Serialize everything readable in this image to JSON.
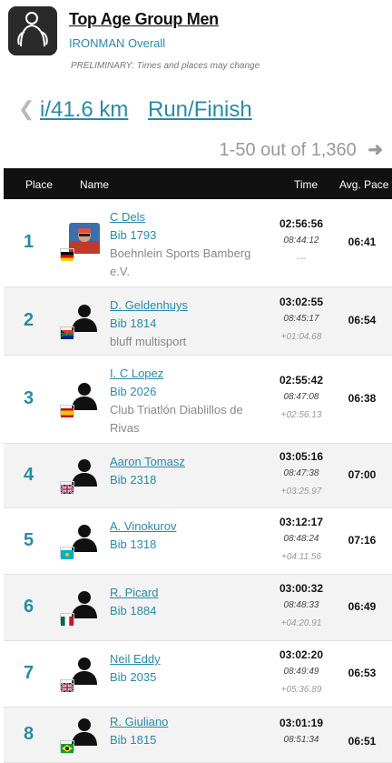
{
  "header": {
    "title": "Top Age Group Men",
    "subtitle": "IRONMAN Overall",
    "notice": "PRELIMINARY: Times and places may change"
  },
  "split_nav": {
    "distance": "i/41.6 km",
    "label": "Run/Finish"
  },
  "paging": {
    "text": "1-50 out of 1,360"
  },
  "table": {
    "headers": {
      "place": "Place",
      "name": "Name",
      "time": "Time",
      "pace": "Avg. Pace"
    },
    "rows": [
      {
        "place": "1",
        "name": "C Dels",
        "bib": "Bib 1793",
        "club_line1": "Boehnlein Sports Bamberg",
        "club_line2": "e.V.",
        "time": "02:56:56",
        "race_time": "08:44:12",
        "gap": "---",
        "pace": "06:41",
        "flag": "germany"
      },
      {
        "place": "2",
        "name": "D. Geldenhuys",
        "bib": "Bib 1814",
        "club_line1": "bluff multisport",
        "club_line2": "",
        "time": "03:02:55",
        "race_time": "08:45:17",
        "gap": "+01:04.68",
        "pace": "06:54",
        "flag": "south-africa"
      },
      {
        "place": "3",
        "name": "I. C Lopez",
        "bib": "Bib 2026",
        "club_line1": "Club Triatlón Diablillos de",
        "club_line2": "Rivas",
        "time": "02:55:42",
        "race_time": "08:47:08",
        "gap": "+02:56.13",
        "pace": "06:38",
        "flag": "spain"
      },
      {
        "place": "4",
        "name": "Aaron Tomasz",
        "bib": "Bib 2318",
        "club_line1": "",
        "club_line2": "",
        "time": "03:05:16",
        "race_time": "08:47:38",
        "gap": "+03:25.97",
        "pace": "07:00",
        "flag": "uk"
      },
      {
        "place": "5",
        "name": "A. Vinokurov",
        "bib": "Bib 1318",
        "club_line1": "",
        "club_line2": "",
        "time": "03:12:17",
        "race_time": "08:48:24",
        "gap": "+04:11.56",
        "pace": "07:16",
        "flag": "kazakhstan"
      },
      {
        "place": "6",
        "name": "R. Picard",
        "bib": "Bib 1884",
        "club_line1": "",
        "club_line2": "",
        "time": "03:00:32",
        "race_time": "08:48:33",
        "gap": "+04:20.91",
        "pace": "06:49",
        "flag": "mexico"
      },
      {
        "place": "7",
        "name": "Neil Eddy",
        "bib": "Bib 2035",
        "club_line1": "",
        "club_line2": "",
        "time": "03:02:20",
        "race_time": "08:49:49",
        "gap": "+05:36.89",
        "pace": "06:53",
        "flag": "uk"
      },
      {
        "place": "8",
        "name": "R. Giuliano",
        "bib": "Bib 1815",
        "club_line1": "",
        "club_line2": "",
        "time": "03:01:19",
        "race_time": "08:51:34",
        "gap": "",
        "pace": "06:51",
        "flag": "brazil"
      }
    ]
  },
  "colors": {
    "accent": "#2a8aa5",
    "header_bg": "#111111",
    "alt_row": "#f3f3f3"
  }
}
